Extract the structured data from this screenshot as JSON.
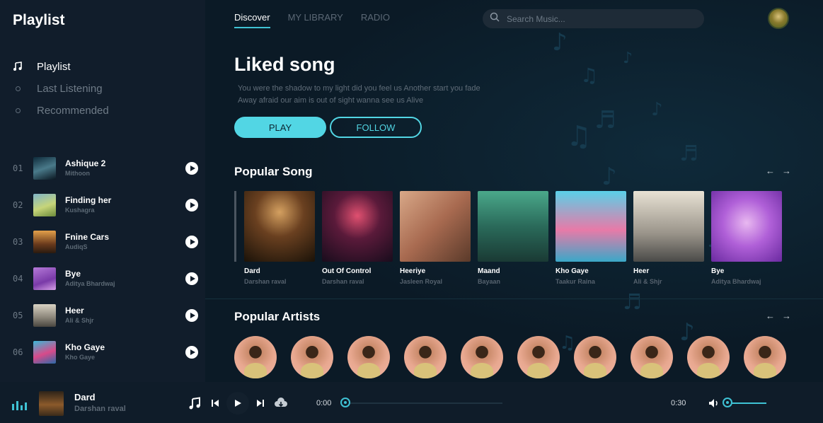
{
  "brand": "Playlist",
  "nav": [
    {
      "label": "Playlist",
      "active": true
    },
    {
      "label": "Last Listening",
      "active": false
    },
    {
      "label": "Recommended",
      "active": false
    }
  ],
  "tracks": [
    {
      "num": "01",
      "title": "Ashique 2",
      "artist": "Mithoon"
    },
    {
      "num": "02",
      "title": "Finding her",
      "artist": "Kushagra"
    },
    {
      "num": "03",
      "title": "Fnine Cars",
      "artist": "AudiqS"
    },
    {
      "num": "04",
      "title": "Bye",
      "artist": "Aditya Bhardwaj"
    },
    {
      "num": "05",
      "title": "Heer",
      "artist": "Ali & Shjr"
    },
    {
      "num": "06",
      "title": "Kho Gaye",
      "artist": "Kho Gaye"
    }
  ],
  "tabs": [
    "Discover",
    "MY LIBRARY",
    "RADIO"
  ],
  "search": {
    "placeholder": "Search Music..."
  },
  "hero": {
    "title": "Liked song",
    "text_line1": "You were the shadow to my light did you feel us Another start you fade",
    "text_line2": "Away afraid our aim is out of sight wanna see us Alive",
    "play_label": "PLAY",
    "follow_label": "FOLLOW"
  },
  "popular_songs": {
    "title": "Popular Song",
    "items": [
      {
        "title": "Dard",
        "artist": "Darshan raval"
      },
      {
        "title": "Out Of Control",
        "artist": "Darshan raval"
      },
      {
        "title": "Heeriye",
        "artist": "Jasleen Royal"
      },
      {
        "title": "Maand",
        "artist": "Bayaan"
      },
      {
        "title": "Kho Gaye",
        "artist": "Taakur Raina"
      },
      {
        "title": "Heer",
        "artist": "Ali & Shjr"
      },
      {
        "title": "Bye",
        "artist": "Aditya Bhardwaj"
      }
    ]
  },
  "popular_artists": {
    "title": "Popular Artists",
    "count": 10
  },
  "player": {
    "title": "Dard",
    "artist": "Darshan raval",
    "elapsed": "0:00",
    "duration": "0:30",
    "progress": 0.0,
    "volume": 0.1
  },
  "colors": {
    "accent": "#3fc2d4",
    "button": "#52d6e4",
    "sidebar": "#111d2b",
    "background": "#0b1a26"
  }
}
